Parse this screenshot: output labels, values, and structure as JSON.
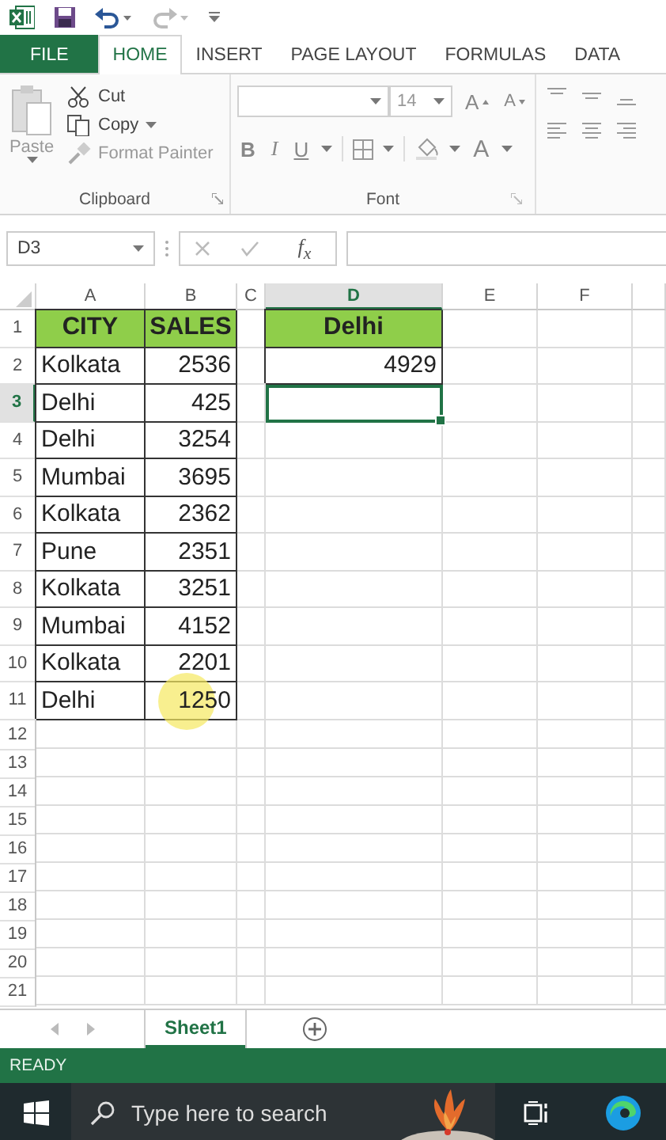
{
  "tabs": [
    {
      "label": "FILE",
      "kind": "file",
      "selected": false
    },
    {
      "label": "HOME",
      "kind": "tab",
      "selected": true
    },
    {
      "label": "INSERT",
      "kind": "tab",
      "selected": false
    },
    {
      "label": "PAGE LAYOUT",
      "kind": "tab",
      "selected": false
    },
    {
      "label": "FORMULAS",
      "kind": "tab",
      "selected": false
    },
    {
      "label": "DATA",
      "kind": "tab",
      "selected": false
    }
  ],
  "clipboard": {
    "paste": "Paste",
    "cut": "Cut",
    "copy": "Copy",
    "format_painter": "Format Painter",
    "label": "Clipboard"
  },
  "font": {
    "size": "14",
    "grow": "A",
    "shrink": "A",
    "bold": "B",
    "italic": "I",
    "underline": "U",
    "font_color": "A",
    "label": "Font"
  },
  "formula_bar": {
    "name_box": "D3",
    "function": "f$_{x}$"
  },
  "columns": [
    {
      "label": "A",
      "selected": false
    },
    {
      "label": "B",
      "selected": false
    },
    {
      "label": "C",
      "selected": false
    },
    {
      "label": "D",
      "selected": true
    },
    {
      "label": "E",
      "selected": false
    },
    {
      "label": "F",
      "selected": false
    }
  ],
  "rows": [
    {
      "number": "1",
      "selected": false,
      "cells": [
        {
          "kind": "heading",
          "text": "CITY",
          "selected": false
        },
        {
          "kind": "heading",
          "text": "SALES",
          "selected": false
        },
        {
          "kind": "blank",
          "selected": false
        },
        {
          "kind": "heading",
          "text": "Delhi",
          "selected": false
        },
        {
          "kind": "blank",
          "selected": false
        },
        {
          "kind": "blank",
          "selected": false
        }
      ]
    },
    {
      "number": "2",
      "selected": false,
      "cells": [
        {
          "kind": "text",
          "text": "Kolkata",
          "selected": false
        },
        {
          "kind": "number",
          "text": "2536",
          "selected": false
        },
        {
          "kind": "blank",
          "selected": false
        },
        {
          "kind": "number",
          "text": "4929",
          "selected": false
        },
        {
          "kind": "blank",
          "selected": false
        },
        {
          "kind": "blank",
          "selected": false
        }
      ]
    },
    {
      "number": "3",
      "selected": true,
      "cells": [
        {
          "kind": "text",
          "text": "Delhi",
          "selected": false
        },
        {
          "kind": "number",
          "text": "425",
          "selected": false
        },
        {
          "kind": "blank",
          "selected": false
        },
        {
          "kind": "blank",
          "selected": true
        },
        {
          "kind": "blank",
          "selected": false
        },
        {
          "kind": "blank",
          "selected": false
        }
      ]
    },
    {
      "number": "4",
      "selected": false,
      "cells": [
        {
          "kind": "text",
          "text": "Delhi",
          "selected": false
        },
        {
          "kind": "number",
          "text": "3254",
          "selected": false
        },
        {
          "kind": "blank",
          "selected": false
        },
        {
          "kind": "blank",
          "selected": false
        },
        {
          "kind": "blank",
          "selected": false
        },
        {
          "kind": "blank",
          "selected": false
        }
      ]
    },
    {
      "number": "5",
      "selected": false,
      "cells": [
        {
          "kind": "text",
          "text": "Mumbai",
          "selected": false
        },
        {
          "kind": "number",
          "text": "3695",
          "selected": false
        },
        {
          "kind": "blank",
          "selected": false
        },
        {
          "kind": "blank",
          "selected": false
        },
        {
          "kind": "blank",
          "selected": false
        },
        {
          "kind": "blank",
          "selected": false
        }
      ]
    },
    {
      "number": "6",
      "selected": false,
      "cells": [
        {
          "kind": "text",
          "text": "Kolkata",
          "selected": false
        },
        {
          "kind": "number",
          "text": "2362",
          "selected": false
        },
        {
          "kind": "blank",
          "selected": false
        },
        {
          "kind": "blank",
          "selected": false
        },
        {
          "kind": "blank",
          "selected": false
        },
        {
          "kind": "blank",
          "selected": false
        }
      ]
    },
    {
      "number": "7",
      "selected": false,
      "cells": [
        {
          "kind": "text",
          "text": "Pune",
          "selected": false
        },
        {
          "kind": "number",
          "text": "2351",
          "selected": false
        },
        {
          "kind": "blank",
          "selected": false
        },
        {
          "kind": "blank",
          "selected": false
        },
        {
          "kind": "blank",
          "selected": false
        },
        {
          "kind": "blank",
          "selected": false
        }
      ]
    },
    {
      "number": "8",
      "selected": false,
      "cells": [
        {
          "kind": "text",
          "text": "Kolkata",
          "selected": false
        },
        {
          "kind": "number",
          "text": "3251",
          "selected": false
        },
        {
          "kind": "blank",
          "selected": false
        },
        {
          "kind": "blank",
          "selected": false
        },
        {
          "kind": "blank",
          "selected": false
        },
        {
          "kind": "blank",
          "selected": false
        }
      ]
    },
    {
      "number": "9",
      "selected": false,
      "cells": [
        {
          "kind": "text",
          "text": "Mumbai",
          "selected": false
        },
        {
          "kind": "number",
          "text": "4152",
          "selected": false
        },
        {
          "kind": "blank",
          "selected": false
        },
        {
          "kind": "blank",
          "selected": false
        },
        {
          "kind": "blank",
          "selected": false
        },
        {
          "kind": "blank",
          "selected": false
        }
      ]
    },
    {
      "number": "10",
      "selected": false,
      "cells": [
        {
          "kind": "text",
          "text": "Kolkata",
          "selected": false
        },
        {
          "kind": "number",
          "text": "2201",
          "selected": false
        },
        {
          "kind": "blank",
          "selected": false
        },
        {
          "kind": "blank",
          "selected": false
        },
        {
          "kind": "blank",
          "selected": false
        },
        {
          "kind": "blank",
          "selected": false
        }
      ]
    },
    {
      "number": "11",
      "selected": false,
      "cells": [
        {
          "kind": "text",
          "text": "Delhi",
          "selected": false
        },
        {
          "kind": "number",
          "text": "1250",
          "selected": false,
          "highlighted": true
        },
        {
          "kind": "blank",
          "selected": false
        },
        {
          "kind": "blank",
          "selected": false
        },
        {
          "kind": "blank",
          "selected": false
        },
        {
          "kind": "blank",
          "selected": false
        }
      ]
    },
    {
      "number": "12",
      "selected": false
    },
    {
      "number": "13",
      "selected": false
    },
    {
      "number": "14",
      "selected": false
    },
    {
      "number": "15",
      "selected": false
    },
    {
      "number": "16",
      "selected": false
    },
    {
      "number": "17",
      "selected": false
    },
    {
      "number": "18",
      "selected": false
    },
    {
      "number": "19",
      "selected": false
    },
    {
      "number": "20",
      "selected": false
    },
    {
      "number": "21",
      "selected": false
    }
  ],
  "sheets": [
    {
      "label": "Sheet1",
      "selected": true
    }
  ],
  "status": "READY",
  "taskbar": {
    "placeholder": "Type here to search"
  }
}
